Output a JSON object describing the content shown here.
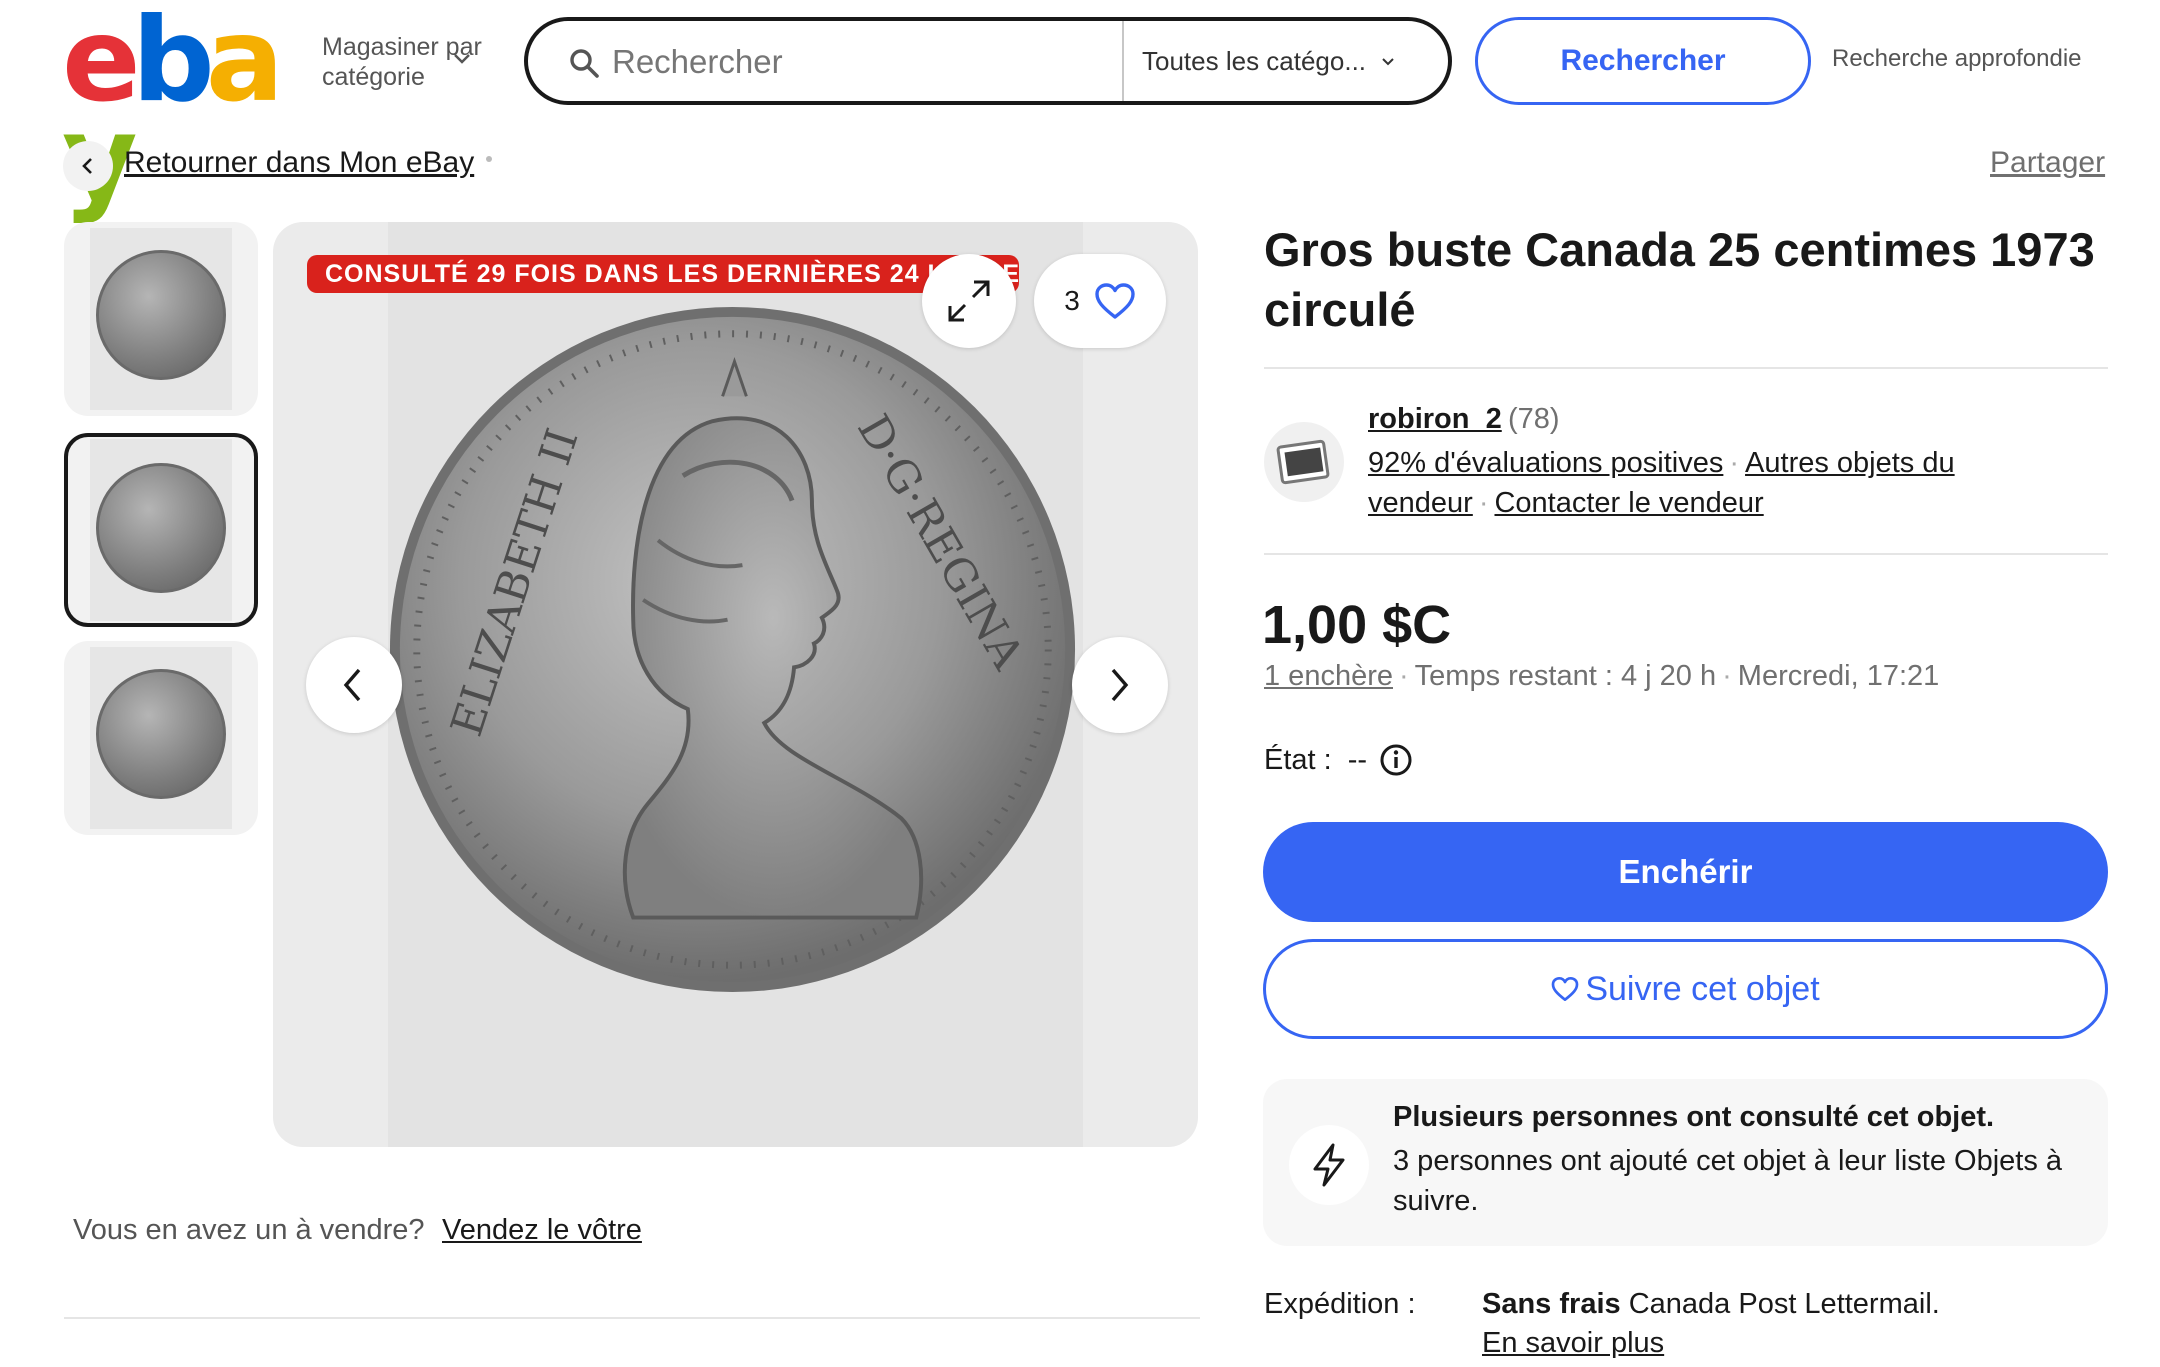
{
  "header": {
    "logo_letters": [
      "e",
      "b",
      "a",
      "y"
    ],
    "logo_colors": [
      "#e53238",
      "#0064d2",
      "#f5af02",
      "#86b817"
    ],
    "shop_by_category": "Magasiner par catégorie",
    "search_placeholder": "Rechercher",
    "category_selected": "Toutes les catégo...",
    "search_button": "Rechercher",
    "advanced_search": "Recherche approfondie"
  },
  "breadcrumb": {
    "back_label": "Retourner dans Mon eBay",
    "share_label": "Partager"
  },
  "gallery": {
    "thumbnails": [
      {
        "name": "thumbnail-1",
        "selected": false
      },
      {
        "name": "thumbnail-2",
        "selected": true
      },
      {
        "name": "thumbnail-3",
        "selected": false
      }
    ],
    "views_badge": "CONSULTÉ 29 FOIS DANS LES DERNIÈRES 24 HEURES",
    "watch_count": "3",
    "coin_legend_left": "ELIZABETH II",
    "coin_legend_right": "D·G·REGINA"
  },
  "sell": {
    "question": "Vous en avez un à vendre?",
    "link": "Vendez le vôtre"
  },
  "item": {
    "title": "Gros buste Canada 25 centimes 1973 circulé",
    "seller": {
      "name": "robiron_2",
      "feedback_count": "(78)",
      "positive": "92% d'évaluations positives",
      "other_items": "Autres objets du vendeur",
      "contact": "Contacter le vendeur"
    },
    "price": "1,00 $C",
    "bids": "1 enchère",
    "time_left": "Temps restant : 4 j 20 h",
    "end_time": "Mercredi, 17:21",
    "condition_label": "État :",
    "condition_value": "--",
    "bid_button": "Enchérir",
    "watch_button": "Suivre cet objet",
    "info_title": "Plusieurs personnes ont consulté cet objet.",
    "info_text": "3 personnes ont ajouté cet objet à leur liste Objets à suivre.",
    "shipping_label": "Expédition :",
    "shipping_free": "Sans frais",
    "shipping_method": "Canada Post Lettermail.",
    "shipping_more": "En savoir plus"
  },
  "colors": {
    "accent": "#3665f3",
    "badge_red": "#d9221c"
  }
}
